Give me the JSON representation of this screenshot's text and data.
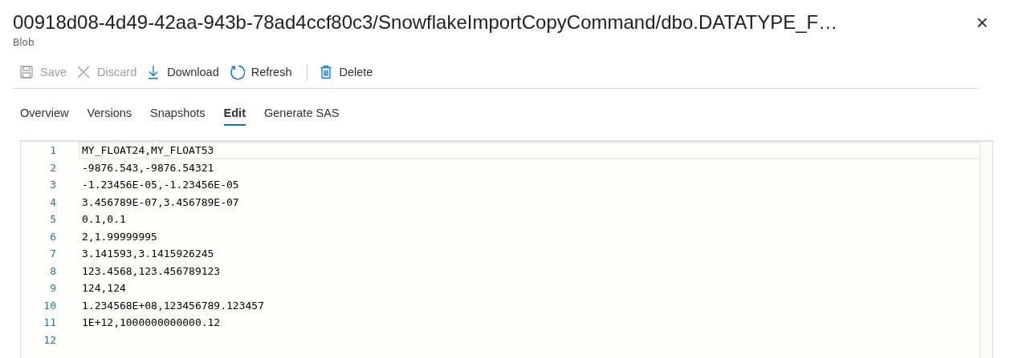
{
  "header": {
    "title": "00918d08-4d49-42aa-943b-78ad4ccf80c3/SnowflakeImportCopyCommand/dbo.DATATYPE_F…",
    "subtitle": "Blob",
    "close": "×"
  },
  "toolbar": [
    {
      "kind": "save",
      "label": "Save",
      "disabled": true
    },
    {
      "kind": "discard",
      "label": "Discard",
      "disabled": true
    },
    {
      "kind": "download",
      "label": "Download",
      "disabled": false
    },
    {
      "kind": "refresh",
      "label": "Refresh",
      "disabled": false
    },
    {
      "kind": "delete",
      "label": "Delete",
      "disabled": false
    }
  ],
  "tabs": [
    {
      "label": "Overview",
      "selected": false
    },
    {
      "label": "Versions",
      "selected": false
    },
    {
      "label": "Snapshots",
      "selected": false
    },
    {
      "label": "Edit",
      "selected": true
    },
    {
      "label": "Generate SAS",
      "selected": false
    }
  ],
  "editor": {
    "lines": [
      {
        "number": "1",
        "text": "MY_FLOAT24,MY_FLOAT53",
        "current": true
      },
      {
        "number": "2",
        "text": "-9876.543,-9876.54321",
        "current": false
      },
      {
        "number": "3",
        "text": "-1.23456E-05,-1.23456E-05",
        "current": false
      },
      {
        "number": "4",
        "text": "3.456789E-07,3.456789E-07",
        "current": false
      },
      {
        "number": "5",
        "text": "0.1,0.1",
        "current": false
      },
      {
        "number": "6",
        "text": "2,1.99999995",
        "current": false
      },
      {
        "number": "7",
        "text": "3.141593,3.1415926245",
        "current": false
      },
      {
        "number": "8",
        "text": "123.4568,123.456789123",
        "current": false
      },
      {
        "number": "9",
        "text": "124,124",
        "current": false
      },
      {
        "number": "10",
        "text": "1.234568E+08,123456789.123457",
        "current": false
      },
      {
        "number": "11",
        "text": "1E+12,1000000000000.12",
        "current": false
      },
      {
        "number": "12",
        "current": false
      }
    ]
  }
}
